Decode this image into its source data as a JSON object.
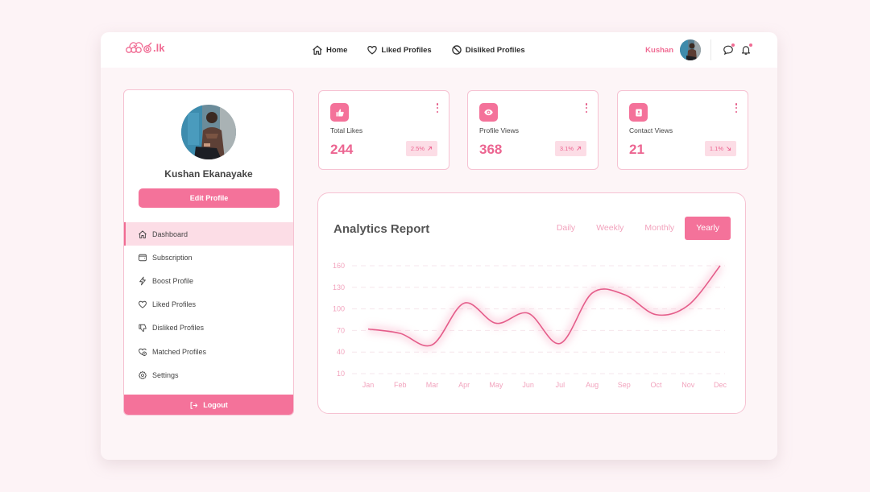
{
  "header": {
    "logo_text": ".lk",
    "nav": [
      {
        "label": "Home",
        "icon": "home-icon"
      },
      {
        "label": "Liked Profiles",
        "icon": "heart-icon"
      },
      {
        "label": "Disliked Profiles",
        "icon": "ban-icon"
      }
    ],
    "user_name": "Kushan",
    "accent_color": "#f06b93"
  },
  "sidebar": {
    "profile_name": "Kushan Ekanayake",
    "edit_label": "Edit Profile",
    "items": [
      {
        "label": "Dashboard",
        "icon": "home-icon",
        "active": true
      },
      {
        "label": "Subscription",
        "icon": "wallet-icon",
        "active": false
      },
      {
        "label": "Boost Profile",
        "icon": "lightning-icon",
        "active": false
      },
      {
        "label": "Liked Profiles",
        "icon": "heart-icon",
        "active": false
      },
      {
        "label": "Disliked Profiles",
        "icon": "thumbs-down-icon",
        "active": false
      },
      {
        "label": "Matched Profiles",
        "icon": "matched-heart-icon",
        "active": false
      },
      {
        "label": "Settings",
        "icon": "gear-icon",
        "active": false
      }
    ],
    "logout_label": "Logout"
  },
  "stats": [
    {
      "label": "Total Likes",
      "value": "244",
      "change": "2.5%",
      "trend": "up",
      "icon": "thumbs-up-icon"
    },
    {
      "label": "Profile Views",
      "value": "368",
      "change": "3.1%",
      "trend": "up",
      "icon": "eye-icon"
    },
    {
      "label": "Contact Views",
      "value": "21",
      "change": "1.1%",
      "trend": "down",
      "icon": "contact-book-icon"
    }
  ],
  "analytics": {
    "title": "Analytics Report",
    "tabs": [
      "Daily",
      "Weekly",
      "Monthly",
      "Yearly"
    ],
    "active_tab": "Yearly"
  },
  "chart_data": {
    "type": "line",
    "title": "Analytics Report",
    "xlabel": "",
    "ylabel": "",
    "categories": [
      "Jan",
      "Feb",
      "Mar",
      "Apr",
      "May",
      "Jun",
      "Jul",
      "Aug",
      "Sep",
      "Oct",
      "Nov",
      "Dec"
    ],
    "series": [
      {
        "name": "Yearly",
        "values": [
          72,
          66,
          50,
          108,
          80,
          94,
          52,
          122,
          120,
          92,
          105,
          160
        ]
      }
    ],
    "y_ticks": [
      10,
      40,
      70,
      100,
      130,
      160
    ],
    "ylim": [
      10,
      160
    ],
    "grid": true,
    "line_color": "#e45d8a"
  }
}
